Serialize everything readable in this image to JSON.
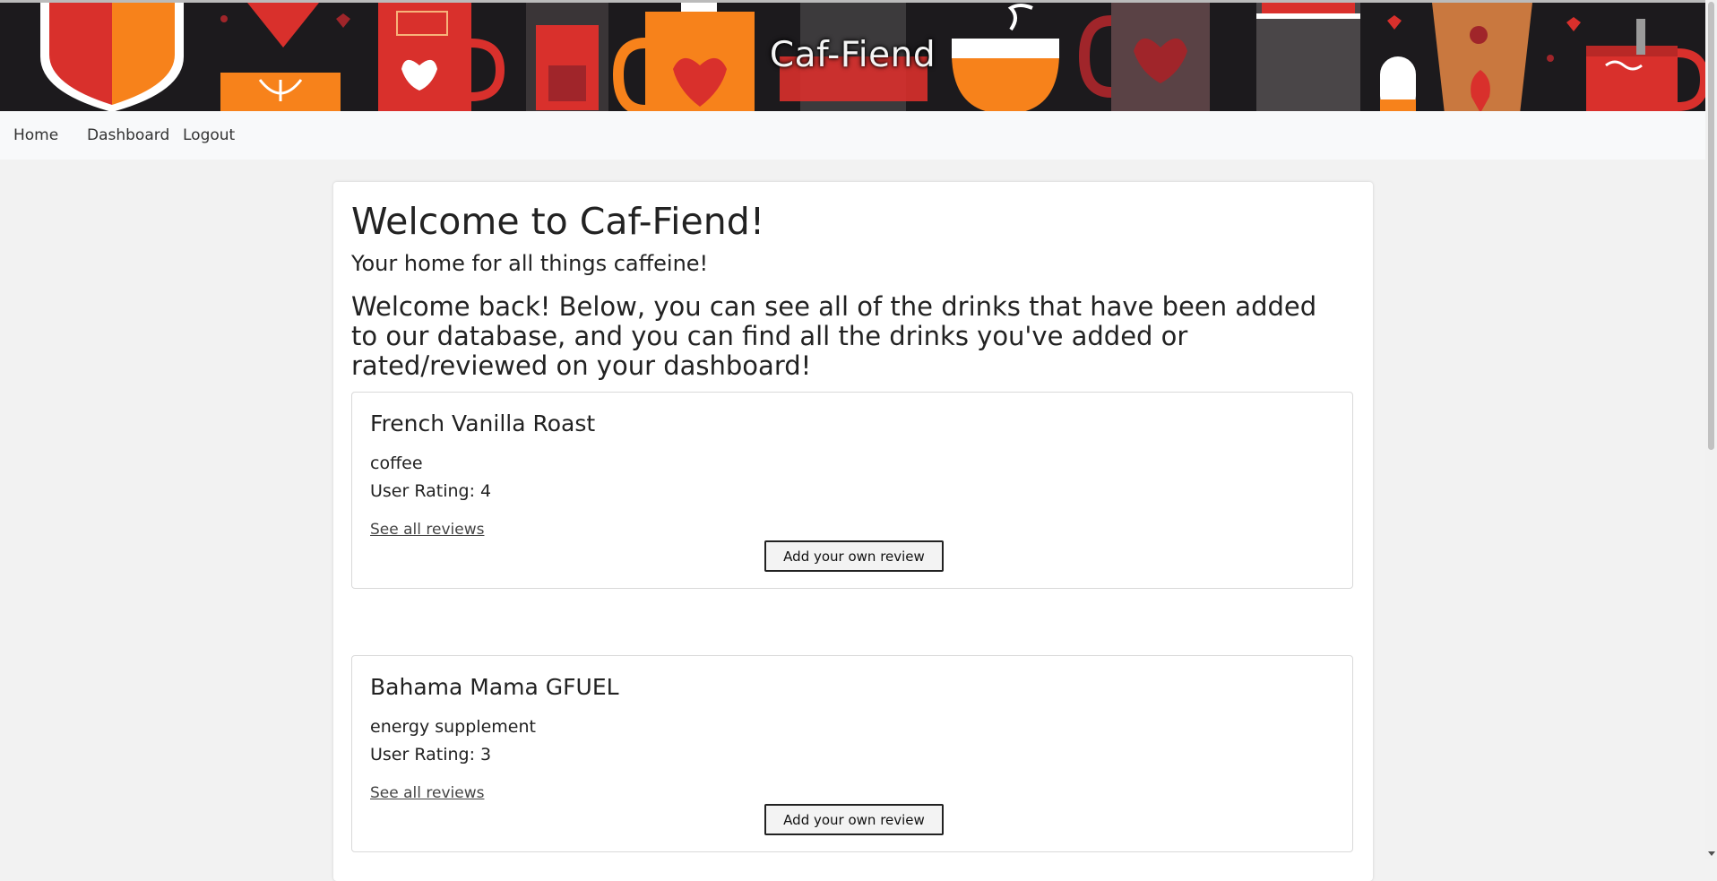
{
  "brand": {
    "title": "Caf-Fiend"
  },
  "nav": {
    "home": "Home",
    "dashboard": "Dashboard",
    "logout": "Logout"
  },
  "main": {
    "title": "Welcome to Caf-Fiend!",
    "tagline": "Your home for all things caffeine!",
    "intro": "Welcome back! Below, you can see all of the drinks that have been added to our database, and you can find all the drinks you've added or rated/reviewed on your dashboard!"
  },
  "drinks": [
    {
      "name": "French Vanilla Roast",
      "type": "coffee",
      "rating": "User Rating: 4",
      "see_reviews": "See all reviews",
      "add_review": "Add your own review"
    },
    {
      "name": "Bahama Mama GFUEL",
      "type": "energy supplement",
      "rating": "User Rating: 3",
      "see_reviews": "See all reviews",
      "add_review": "Add your own review"
    }
  ],
  "colors": {
    "banner_bg": "#1c1a1d",
    "accent_red": "#d9302c",
    "accent_orange": "#f7821b",
    "nav_bg": "#f8f9fa"
  }
}
